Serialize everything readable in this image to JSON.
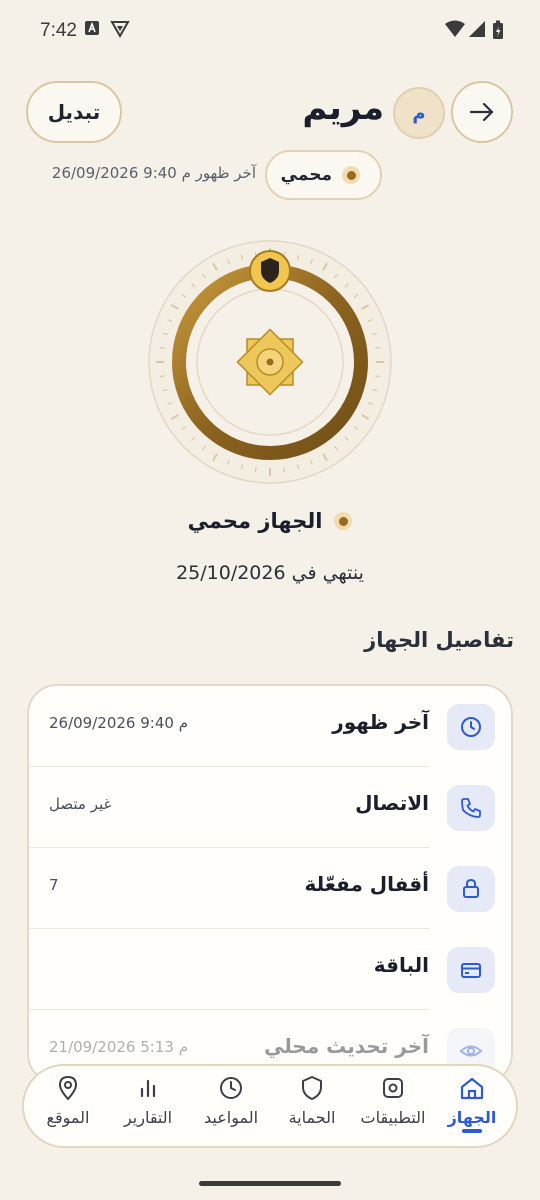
{
  "status_bar": {
    "time": "7:42"
  },
  "header": {
    "switch_label": "تبديل",
    "name": "مريم",
    "avatar_initial": "م",
    "last_seen": "آخر ظهور م 9:40 26/09/2026",
    "protected_label": "محمي"
  },
  "device": {
    "status": "الجهاز محمي",
    "expires": "ينتهي في 25/10/2026"
  },
  "section_title": "تفاصيل الجهاز",
  "details": [
    {
      "label": "آخر ظهور",
      "value": "م 9:40 26/09/2026",
      "icon": "clock-icon"
    },
    {
      "label": "الاتصال",
      "value": "غير متصل",
      "icon": "phone-icon"
    },
    {
      "label": "أقفال مفعّلة",
      "value": "7",
      "icon": "lock-icon"
    },
    {
      "label": "الباقة",
      "value": "",
      "icon": "card-icon"
    },
    {
      "label": "آخر تحديث محلي",
      "value": "م 5:13 21/09/2026",
      "icon": "eye-icon"
    }
  ],
  "nav": [
    {
      "label": "الجهاز",
      "icon": "home-icon",
      "active": true
    },
    {
      "label": "التطبيقات",
      "icon": "apps-icon"
    },
    {
      "label": "الحماية",
      "icon": "shield-icon"
    },
    {
      "label": "المواعيد",
      "icon": "clock-icon"
    },
    {
      "label": "التقارير",
      "icon": "chart-icon"
    },
    {
      "label": "الموقع",
      "icon": "location-icon"
    }
  ],
  "colors": {
    "accent": "#2d5bd0",
    "gold": "#9a6a1e",
    "background": "#f6f1e8"
  }
}
